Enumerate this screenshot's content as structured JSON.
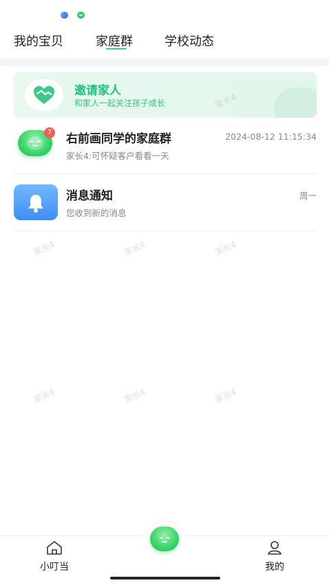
{
  "status_bar": {
    "icons": [
      "app-notification-icon",
      "chat-notification-icon"
    ]
  },
  "tabs": [
    {
      "label": "我的宝贝"
    },
    {
      "label": "家庭群",
      "active": true
    },
    {
      "label": "学校动态"
    }
  ],
  "invite": {
    "title": "邀请家人",
    "subtitle": "和家人一起关注孩子成长",
    "icon": "handshake-icon"
  },
  "messages": [
    {
      "title": "右前画同学的家庭群",
      "time": "2024-08-12 11:15:34",
      "preview": "家长4:可怀疑客户看看一天",
      "badge": "7",
      "icon": "baby-face-icon"
    },
    {
      "title": "消息通知",
      "time": "周一",
      "preview": "您收到新的消息",
      "icon": "bell-icon"
    }
  ],
  "watermark": "家长4",
  "bottom_nav": {
    "home_label": "小叮当",
    "mine_label": "我的",
    "center_icon": "baby-face-icon"
  },
  "colors": {
    "accent_green": "#3ec98a",
    "badge_red": "#f25e58",
    "notice_blue": "#4d9bf7"
  }
}
